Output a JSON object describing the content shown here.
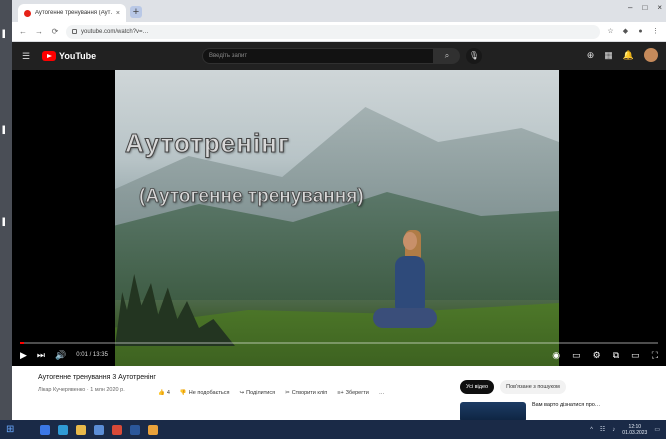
{
  "browser": {
    "tab_title": "Аутогенне тренування (Аут…",
    "tab_close": "×",
    "new_tab": "+",
    "url": "youtube.com/watch?v=…",
    "window_controls": [
      "–",
      "□",
      "×"
    ],
    "nav": [
      "←",
      "→",
      "⟳"
    ]
  },
  "youtube": {
    "logo_text": "YouTube",
    "search_placeholder": "Введіть запит",
    "search_icon": "search-icon",
    "mic_icon": "mic-icon",
    "header_icons": [
      "create-icon",
      "apps-icon",
      "notifications-icon"
    ]
  },
  "video": {
    "overlay_title": "Аутотренінг",
    "overlay_subtitle": "(Аутогенне тренування)",
    "time": "0:01 / 13:35",
    "progress_fraction": 0.006
  },
  "below": {
    "title": "Аутогенне тренування 3 Аутотренінг",
    "channel": "Лікар Кучерявенко · 1 млн  2020 р.",
    "actions": [
      {
        "icon": "like-icon",
        "label": "4"
      },
      {
        "icon": "dislike-icon",
        "label": "Не подобається"
      },
      {
        "icon": "share-icon",
        "label": "Поділитися"
      },
      {
        "icon": "clip-icon",
        "label": "Створити кліп"
      },
      {
        "icon": "save-icon",
        "label": "Зберегти"
      },
      {
        "icon": "more-icon",
        "label": "…"
      }
    ],
    "chips": [
      "Усі відео",
      "Пов'язане з пошуком"
    ],
    "rec_title": "Вам варто дізнатися про…"
  },
  "taskbar": {
    "clock_time": "12:10",
    "clock_date": "01.03.2023"
  },
  "colors": {
    "yt_red": "#ff0000",
    "yt_dark": "#212121",
    "taskbar": "#1a2a47"
  }
}
